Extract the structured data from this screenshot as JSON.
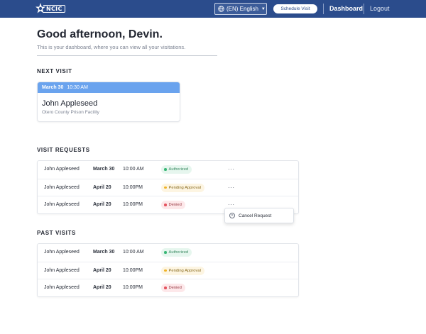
{
  "header": {
    "logo_text": "NCIC",
    "language": "(EN) English",
    "schedule_label": "Schedule Visit",
    "nav": {
      "dashboard": "Dashboard",
      "logout": "Logout"
    },
    "colors": {
      "bar": "#2b4c8c"
    }
  },
  "greeting": {
    "title": "Good afternoon, Devin.",
    "subtitle": "This is your dashboard, where you can view all your visitations."
  },
  "next_visit": {
    "section_title": "NEXT VISIT",
    "date": "March 30",
    "time": "10:30 AM",
    "name": "John Appleseed",
    "facility": "Otero County Prison Facility"
  },
  "visit_requests": {
    "section_title": "VISIT REQUESTS",
    "rows": [
      {
        "name": "John Appleseed",
        "date": "March 30",
        "time": "10:00 AM",
        "status": "Authorized",
        "status_type": "authorized"
      },
      {
        "name": "John Appleseed",
        "date": "April 20",
        "time": "10:00PM",
        "status": "Pending Approval",
        "status_type": "pending"
      },
      {
        "name": "John Appleseed",
        "date": "April 20",
        "time": "10:00PM",
        "status": "Denied",
        "status_type": "denied"
      }
    ],
    "more_label": "···",
    "menu": {
      "cancel_label": "Cancel Request"
    }
  },
  "past_visits": {
    "section_title": "PAST VISITS",
    "rows": [
      {
        "name": "John Appleseed",
        "date": "March 30",
        "time": "10:00 AM",
        "status": "Authorized",
        "status_type": "authorized"
      },
      {
        "name": "John Appleseed",
        "date": "April 20",
        "time": "10:00PM",
        "status": "Pending Approval",
        "status_type": "pending"
      },
      {
        "name": "John Appleseed",
        "date": "April 20",
        "time": "10:00PM",
        "status": "Denied",
        "status_type": "denied"
      }
    ]
  }
}
